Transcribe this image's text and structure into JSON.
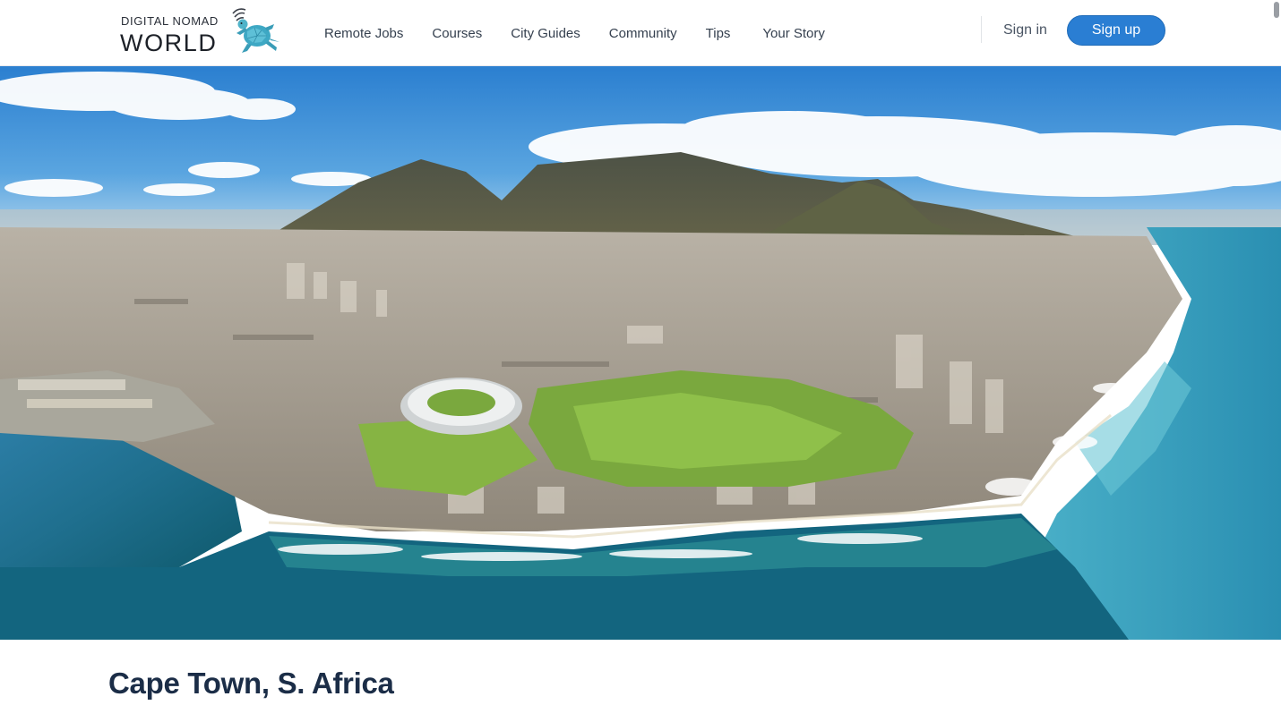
{
  "brand": {
    "line1": "DIGITAL NOMAD",
    "line2": "WORLD",
    "icon": "turtle-icon"
  },
  "nav": {
    "items": [
      {
        "label": "Remote Jobs"
      },
      {
        "label": "Courses"
      },
      {
        "label": "City Guides"
      },
      {
        "label": "Community"
      },
      {
        "label": "Tips"
      },
      {
        "label": "Your Story"
      }
    ]
  },
  "auth": {
    "signin_label": "Sign in",
    "signup_label": "Sign up"
  },
  "hero": {
    "image": "aerial-city-photo"
  },
  "page": {
    "title": "Cape Town, S. Africa"
  },
  "colors": {
    "accent": "#2a7ed3",
    "title": "#1b2d47",
    "nav_text": "#35404f"
  }
}
